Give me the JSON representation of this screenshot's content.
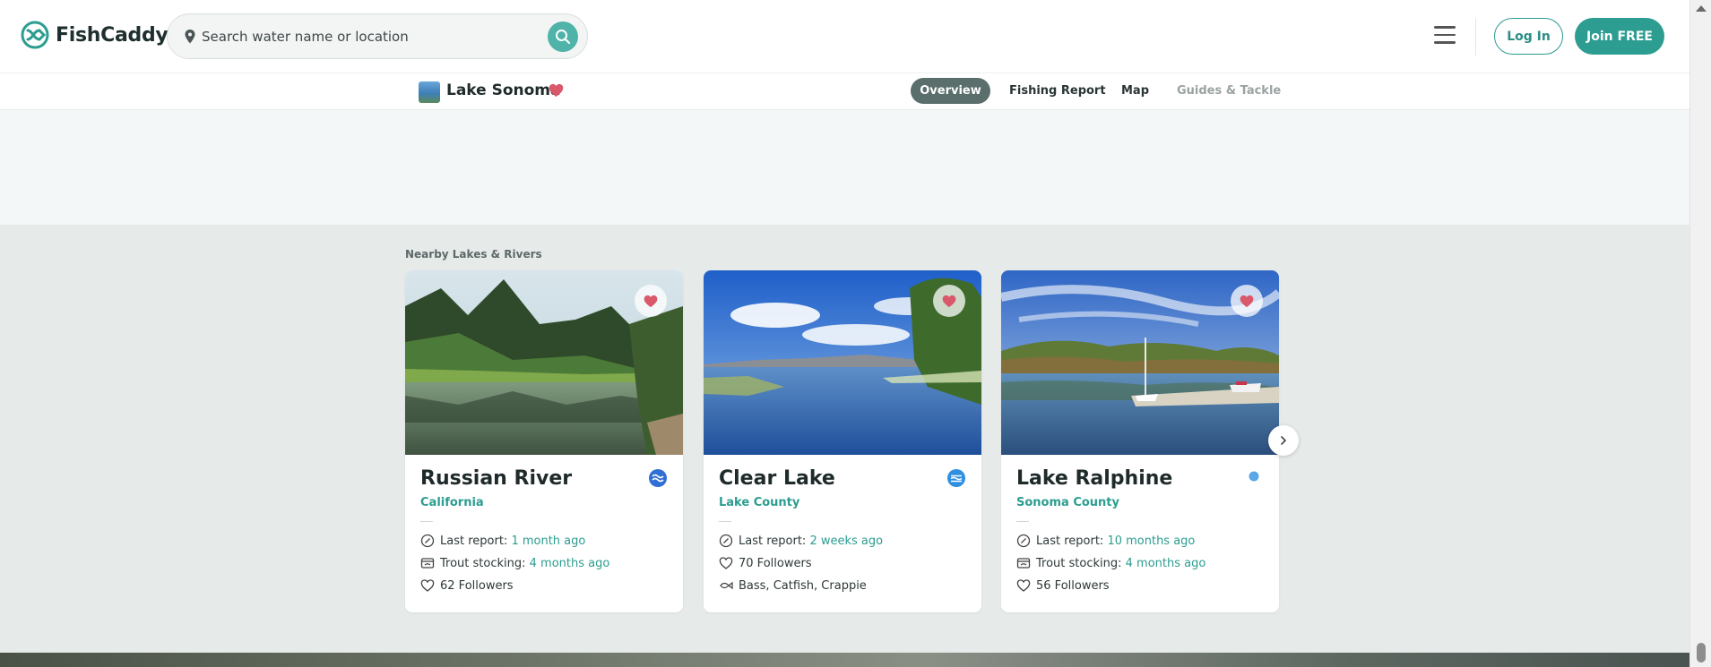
{
  "header": {
    "brand": "FishCaddy",
    "search_placeholder": "Search water name or location",
    "login_label": "Log In",
    "join_label": "Join FREE"
  },
  "subnav": {
    "lake_name": "Lake Sonoma",
    "tabs": [
      {
        "label": "Overview",
        "active": true
      },
      {
        "label": "Fishing Report",
        "active": false
      },
      {
        "label": "Map",
        "active": false
      },
      {
        "label": "Guides & Tackle",
        "active": false
      }
    ]
  },
  "nearby": {
    "label": "Nearby Lakes & Rivers",
    "cards": [
      {
        "title": "Russian River",
        "subtitle": "California",
        "type_icon": "river-wave-icon",
        "meta": [
          {
            "icon": "report-icon",
            "label": "Last report: ",
            "value": "1 month ago"
          },
          {
            "icon": "stocking-icon",
            "label": "Trout stocking: ",
            "value": "4 months ago"
          },
          {
            "icon": "heart-outline-icon",
            "label": "62 Followers",
            "value": ""
          }
        ]
      },
      {
        "title": "Clear Lake",
        "subtitle": "Lake County",
        "type_icon": "lake-wave-icon",
        "meta": [
          {
            "icon": "report-icon",
            "label": "Last report: ",
            "value": "2 weeks ago"
          },
          {
            "icon": "heart-outline-icon",
            "label": "70 Followers",
            "value": ""
          },
          {
            "icon": "fish-icon",
            "label": "Bass, Catfish, Crappie",
            "value": ""
          }
        ]
      },
      {
        "title": "Lake Ralphine",
        "subtitle": "Sonoma County",
        "type_icon": "pond-dot-icon",
        "meta": [
          {
            "icon": "report-icon",
            "label": "Last report: ",
            "value": "10 months ago"
          },
          {
            "icon": "stocking-icon",
            "label": "Trout stocking: ",
            "value": "4 months ago"
          },
          {
            "icon": "heart-outline-icon",
            "label": "56 Followers",
            "value": ""
          }
        ]
      }
    ]
  },
  "colors": {
    "brand": "#2c9d90",
    "favorite": "#d9586a",
    "page_bg": "#e6ebea"
  }
}
